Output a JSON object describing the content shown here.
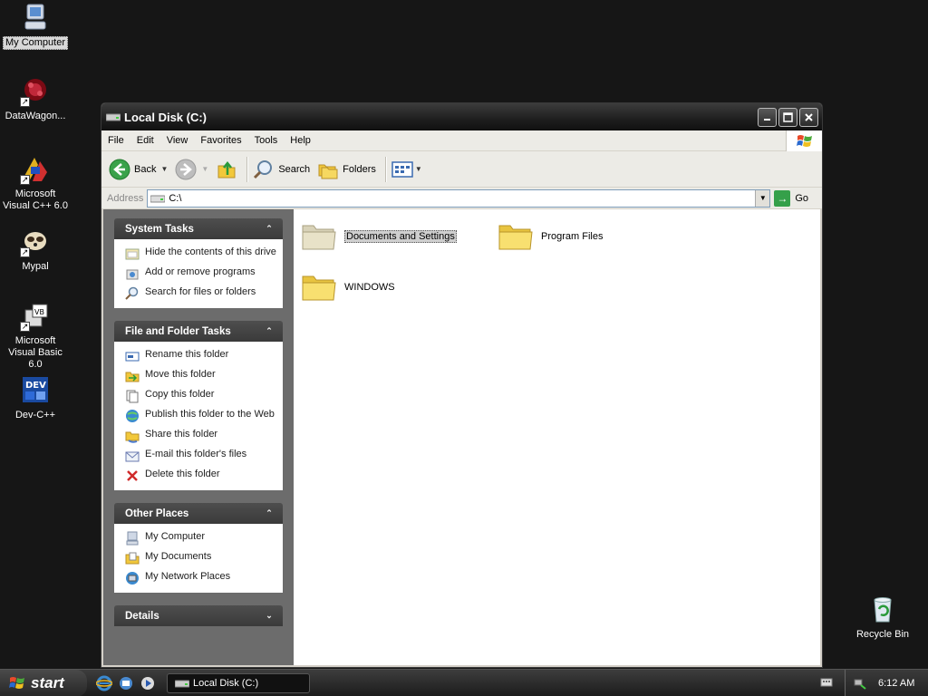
{
  "desktop": {
    "icons": [
      {
        "label": "My Computer",
        "icon": "my-computer-icon"
      },
      {
        "label": "DataWagon...",
        "icon": "datawagon-icon"
      },
      {
        "label": "Microsoft Visual C++ 6.0",
        "icon": "visual-cpp-icon"
      },
      {
        "label": "Mypal",
        "icon": "mypal-icon"
      },
      {
        "label": "Microsoft Visual Basic 6.0",
        "icon": "visual-basic-icon"
      },
      {
        "label": "Dev-C++",
        "icon": "dev-cpp-icon"
      },
      {
        "label": "Recycle Bin",
        "icon": "recycle-bin-icon"
      }
    ]
  },
  "window": {
    "title": "Local Disk (C:)",
    "menu": [
      "File",
      "Edit",
      "View",
      "Favorites",
      "Tools",
      "Help"
    ],
    "toolbar": {
      "back_label": "Back",
      "search_label": "Search",
      "folders_label": "Folders"
    },
    "address": {
      "label": "Address",
      "value": "C:\\",
      "go_label": "Go"
    },
    "taskpane": {
      "system_tasks": {
        "title": "System Tasks",
        "items": [
          "Hide the contents of this drive",
          "Add or remove programs",
          "Search for files or folders"
        ]
      },
      "file_folder_tasks": {
        "title": "File and Folder Tasks",
        "items": [
          "Rename this folder",
          "Move this folder",
          "Copy this folder",
          "Publish this folder to the Web",
          "Share this folder",
          "E-mail this folder's files",
          "Delete this folder"
        ]
      },
      "other_places": {
        "title": "Other Places",
        "items": [
          "My Computer",
          "My Documents",
          "My Network Places"
        ]
      },
      "details": {
        "title": "Details"
      }
    },
    "folders": [
      "Documents and Settings",
      "Program Files",
      "WINDOWS"
    ]
  },
  "taskbar": {
    "start_label": "start",
    "task_label": "Local Disk (C:)",
    "clock": "6:12 AM"
  }
}
